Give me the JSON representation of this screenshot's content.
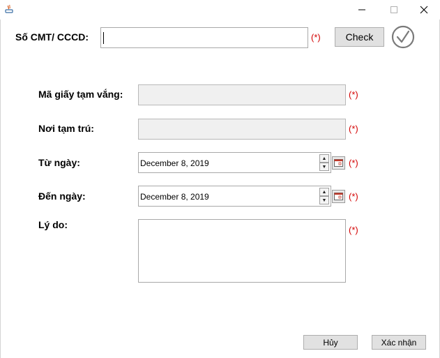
{
  "window": {
    "minimize_glyph": "—",
    "maximize_glyph": "☐",
    "close_glyph": "✕"
  },
  "form": {
    "id_label": "Số CMT/ CCCD:",
    "id_value": "",
    "required_mark": "(*)",
    "check_label": "Check",
    "permit_code_label": "Mã giấy tạm vắng:",
    "permit_code_value": "",
    "residence_label": "Nơi tạm trú:",
    "residence_value": "",
    "from_date_label": "Từ ngày:",
    "from_date_value": "December 8, 2019",
    "to_date_label": "Đến ngày:",
    "to_date_value": "December 8, 2019",
    "reason_label": "Lý do:",
    "reason_value": ""
  },
  "buttons": {
    "cancel": "Hủy",
    "confirm": "Xác nhận"
  },
  "colors": {
    "required": "#d30000",
    "check_icon": "#7a7a7a"
  }
}
